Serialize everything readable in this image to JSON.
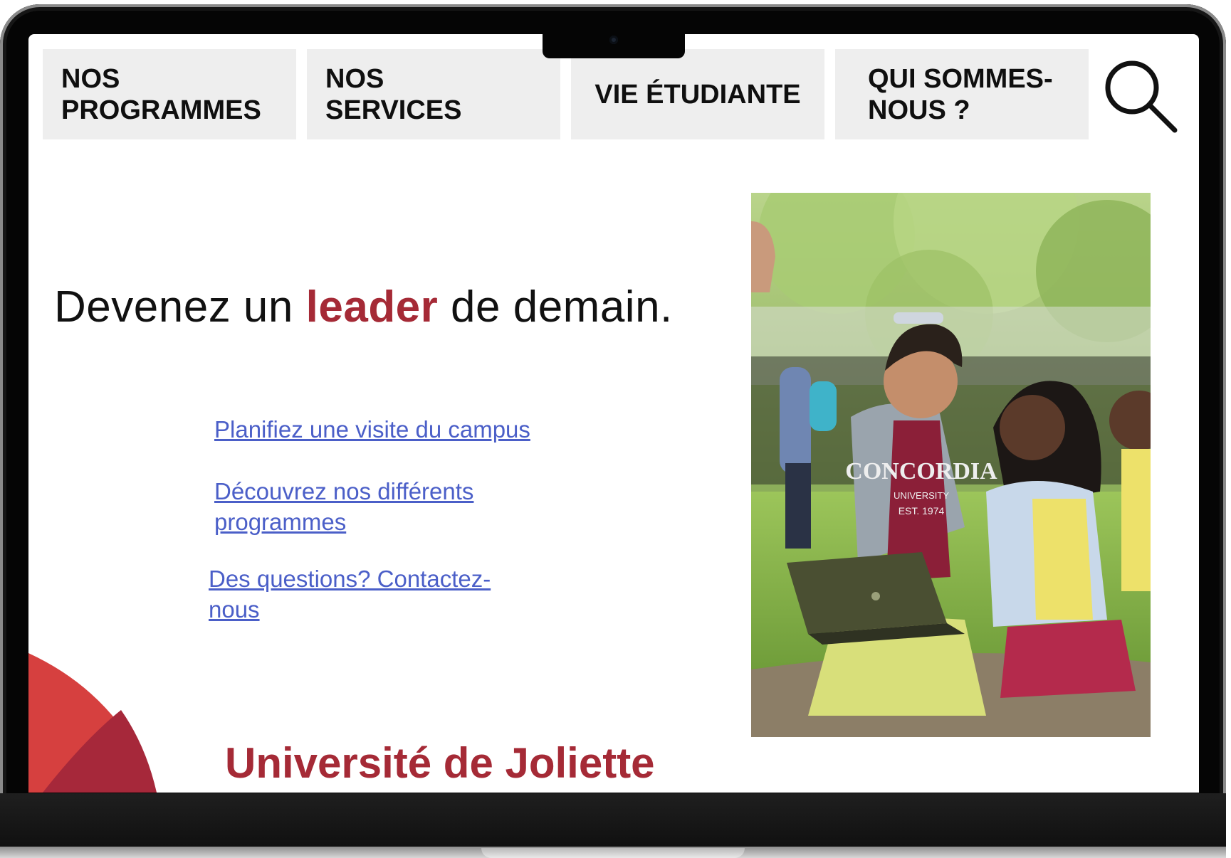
{
  "nav": {
    "items": [
      {
        "lines": [
          "NOS",
          "PROGRAMMES"
        ]
      },
      {
        "lines": [
          "NOS",
          "SERVICES"
        ]
      },
      {
        "lines": [
          "VIE ÉTUDIANTE"
        ]
      },
      {
        "lines": [
          "QUI SOMMES-",
          "NOUS ?"
        ]
      }
    ],
    "search_icon": "search-icon"
  },
  "hero": {
    "headline_before": "Devenez un ",
    "headline_accent": "leader",
    "headline_after": " de demain."
  },
  "links": [
    {
      "lines": [
        "Planifiez une visite du campus"
      ]
    },
    {
      "lines": [
        "Découvrez nos différents",
        "programmes"
      ]
    },
    {
      "lines": [
        "Des questions? Contactez-",
        "nous"
      ]
    }
  ],
  "brand": {
    "name": "Université de Joliette"
  },
  "photo": {
    "shirt_line1": "CONCORDIA",
    "shirt_line2": "UNIVERSITY",
    "shirt_line3": "EST. 1974"
  },
  "colors": {
    "accent": "#a52a36",
    "link": "#4b5fc8",
    "nav_bg": "#eeeeee",
    "deco_light": "#d6403f",
    "deco_dark": "#a6283a"
  }
}
